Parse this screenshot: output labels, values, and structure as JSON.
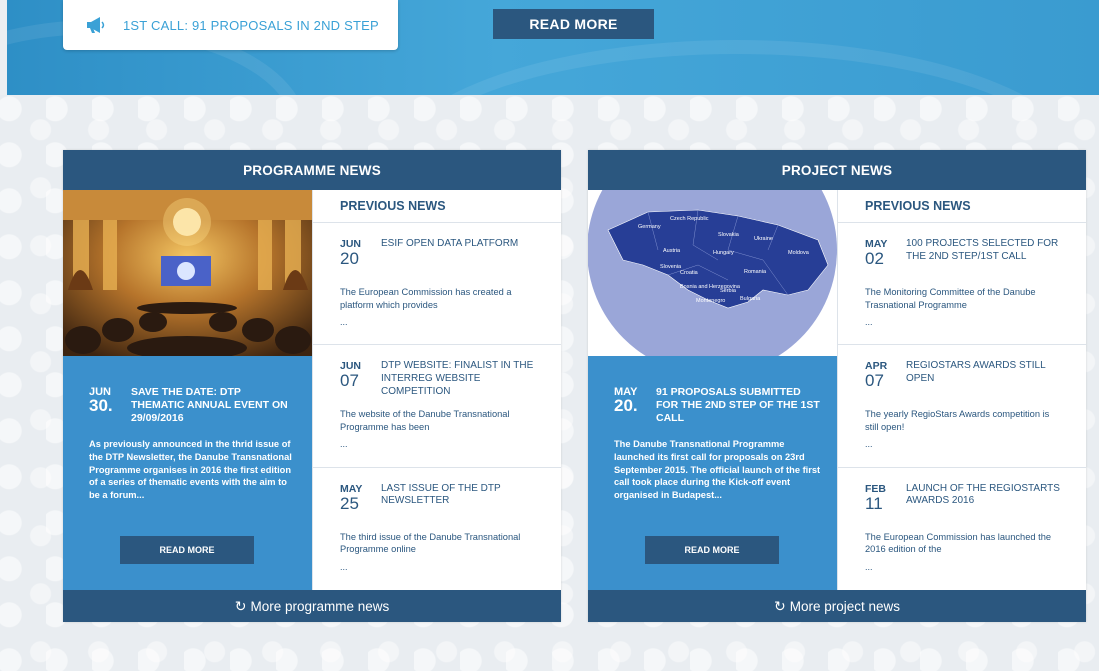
{
  "announcement": {
    "icon": "megaphone-icon",
    "text": "1ST CALL: 91 PROPOSALS IN 2ND STEP"
  },
  "hero": {
    "read_more": "READ MORE"
  },
  "colors": {
    "dark_blue": "#2b577f",
    "mid_blue": "#3b90cc",
    "hero_blue": "#45a7d9",
    "link_blue": "#3aa1d6"
  },
  "programme_news": {
    "header": "PROGRAMME NEWS",
    "featured": {
      "month": "JUN",
      "day": "30.",
      "title": "SAVE THE DATE: DTP THEMATIC ANNUAL EVENT ON 29/09/2016",
      "text": "As previously announced in the thrid issue of the DTP Newsletter, the Danube Transnational Programme organises in 2016 the first edition of a series of thematic events with the aim to be a forum...",
      "read_more": "READ MORE"
    },
    "previous_title": "PREVIOUS NEWS",
    "items": [
      {
        "month": "JUN",
        "day": "20",
        "title": "ESIF OPEN DATA PLATFORM",
        "text": "The European Commission has created a platform which provides",
        "dots": "..."
      },
      {
        "month": "JUN",
        "day": "07",
        "title": "DTP WEBSITE: FINALIST IN THE INTERREG WEBSITE COMPETITION",
        "text": "The website of the Danube Transnational Programme has been",
        "dots": "..."
      },
      {
        "month": "MAY",
        "day": "25",
        "title": "LAST ISSUE OF THE DTP NEWSLETTER",
        "text": "The third issue of the Danube Transnational Programme online",
        "dots": "..."
      }
    ],
    "more": "More programme news"
  },
  "project_news": {
    "header": "PROJECT NEWS",
    "featured": {
      "month": "MAY",
      "day": "20.",
      "title": "91 PROPOSALS SUBMITTED FOR THE 2ND STEP OF THE 1ST CALL",
      "text": "The Danube Transnational Programme launched its first call for proposals on 23rd September 2015. The official launch of the first call took place during the Kick-off event organised in Budapest...",
      "read_more": "READ MORE"
    },
    "map_labels": [
      "Germany",
      "Czech Republic",
      "Slovakia",
      "Ukraine",
      "Austria",
      "Hungary",
      "Moldova",
      "Slovenia",
      "Croatia",
      "Romania",
      "Bosnia and Herzegovina",
      "Serbia",
      "Montenegro",
      "Bulgaria"
    ],
    "previous_title": "PREVIOUS NEWS",
    "items": [
      {
        "month": "MAY",
        "day": "02",
        "title": "100 PROJECTS SELECTED FOR THE 2ND STEP/1ST CALL",
        "text": "The Monitoring Committee of the Danube Trasnational Programme",
        "dots": "..."
      },
      {
        "month": "APR",
        "day": "07",
        "title": "REGIOSTARS AWARDS STILL OPEN",
        "text": "The yearly RegioStars Awards competition is still open!",
        "dots": "..."
      },
      {
        "month": "FEB",
        "day": "11",
        "title": "LAUNCH OF THE REGIOSTARTS AWARDS 2016",
        "text": "The European Commission has launched the 2016 edition of the",
        "dots": "..."
      }
    ],
    "more": "More project news"
  }
}
